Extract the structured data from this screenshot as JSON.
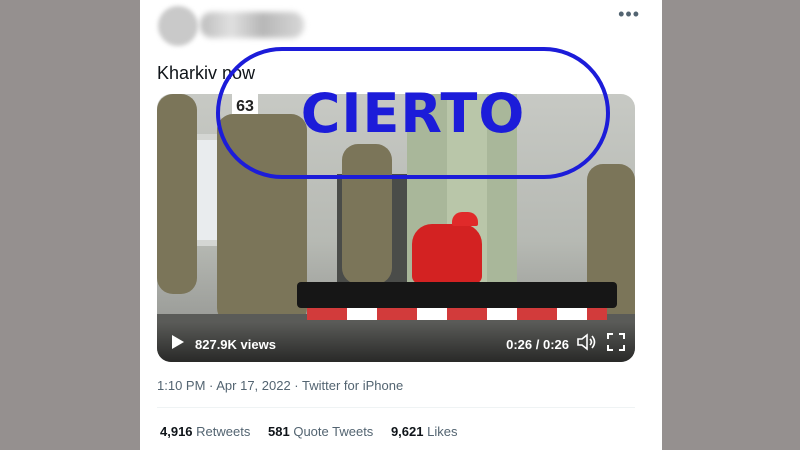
{
  "tweet": {
    "text": "Kharkiv now",
    "more_icon": "more-horizontal-icon",
    "video": {
      "views": "827.9K views",
      "time": "0:26 / 0:26",
      "sign_number": "63",
      "icons": [
        "play-icon",
        "volume-icon",
        "fullscreen-icon"
      ]
    },
    "overlay": {
      "label": "CIERTO",
      "color": "#1c1cd9"
    },
    "meta": "1:10 PM · Apr 17, 2022 · Twitter for iPhone",
    "stats": {
      "retweets_count": "4,916",
      "retweets_label": "Retweets",
      "quotes_count": "581",
      "quotes_label": "Quote Tweets",
      "likes_count": "9,621",
      "likes_label": "Likes"
    }
  },
  "colors": {
    "page_bg": "#95908f",
    "card_bg": "#ffffff",
    "muted_text": "#536471"
  }
}
